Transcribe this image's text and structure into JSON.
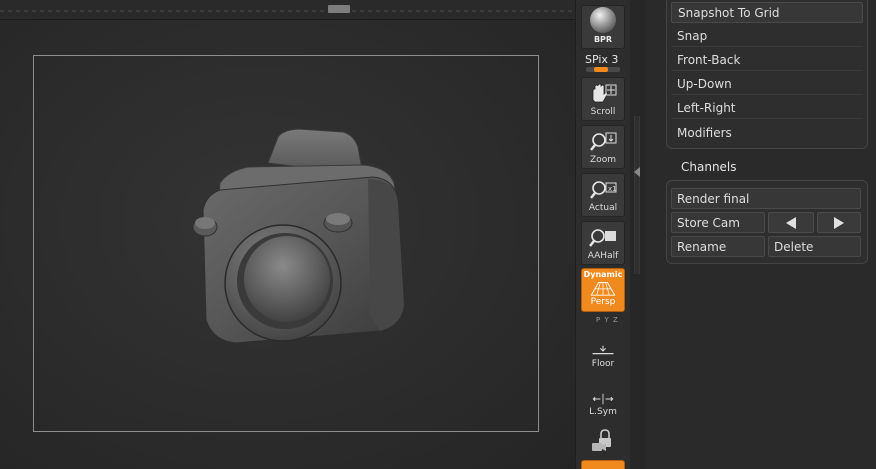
{
  "shelf": {
    "bpr_label": "BPR",
    "spix_label": "SPix 3",
    "spix_value": 3,
    "buttons": {
      "scroll": "Scroll",
      "zoom": "Zoom",
      "actual": "Actual",
      "aahalf": "AAHalf",
      "persp_top": "Dynamic",
      "persp": "Persp",
      "persp_sub": "P Y Z",
      "floor": "Floor",
      "lsym": "L.Sym"
    },
    "icons": [
      "hand-scroll-icon",
      "zoom-icon",
      "actual-size-icon",
      "aahalf-icon",
      "perspective-grid-icon",
      "floor-icon",
      "lsym-icon",
      "lock-camera-icon"
    ]
  },
  "palette": {
    "draw_items": [
      "Snapshot To Grid",
      "Snap",
      "Front-Back",
      "Up-Down",
      "Left-Right",
      "Modifiers"
    ],
    "channels_title": "Channels",
    "channels": {
      "render_final": "Render final",
      "store_cam": "Store Cam",
      "rename": "Rename",
      "delete": "Delete"
    }
  },
  "colors": {
    "accent": "#f08a1e",
    "background": "#262626",
    "panel": "#2e2e2e",
    "frame": "#8e8e8e"
  }
}
